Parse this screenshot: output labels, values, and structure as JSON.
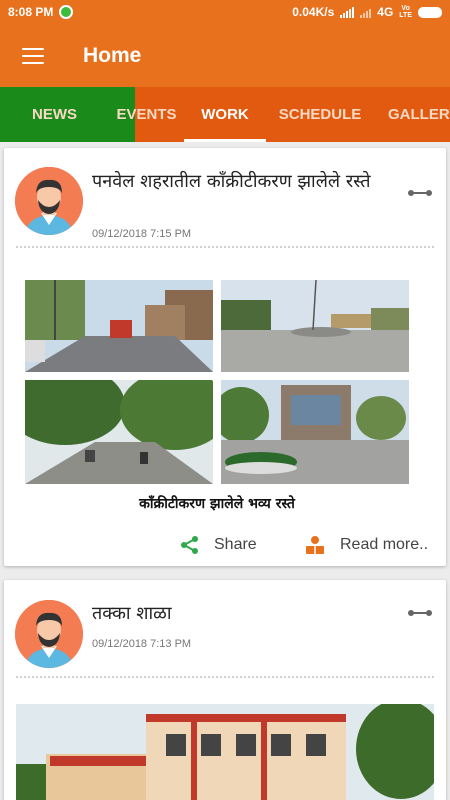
{
  "status_bar": {
    "time": "8:08 PM",
    "net_speed": "0.04K/s",
    "network": "4G",
    "volte": "Vo\nLTE"
  },
  "app_bar": {
    "title": "Home"
  },
  "tabs": [
    {
      "label": "NEWS",
      "active": false
    },
    {
      "label": "EVENTS",
      "active": false
    },
    {
      "label": "WORK",
      "active": true
    },
    {
      "label": "SCHEDULE",
      "active": false
    },
    {
      "label": "GALLERY",
      "active": false
    }
  ],
  "posts": [
    {
      "title": "पनवेल शहरातील काँक्रीटीकरण झालेले रस्ते",
      "date": "09/12/2018 7:15 PM",
      "image_caption": "काँक्रीटीकरण झालेले भव्य रस्ते",
      "share_label": "Share",
      "read_more_label": "Read more.."
    },
    {
      "title": "तक्का शाळा",
      "date": "09/12/2018 7:13 PM"
    }
  ],
  "colors": {
    "primary": "#e8711e",
    "tab_green": "#1a8a1a",
    "tab_orange": "#e25a0f",
    "share_icon": "#2ea84a",
    "read_icon": "#e8711e"
  }
}
